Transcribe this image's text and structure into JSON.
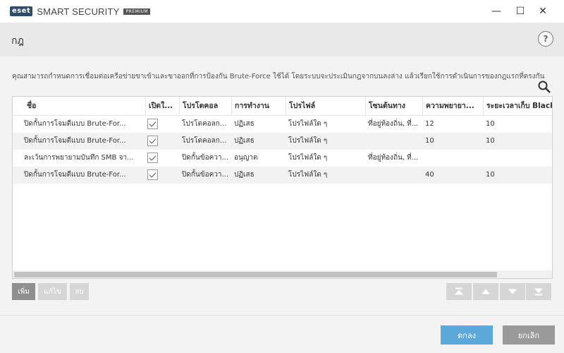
{
  "window": {
    "logo_text": "eset",
    "app_name": "SMART SECURITY",
    "edition": "PREMIUM",
    "minimize_glyph": "—",
    "maximize_glyph": "☐",
    "close_glyph": "✕"
  },
  "header": {
    "title": "กฎ",
    "help_label": "?"
  },
  "description": "คุณสามารถกำหนดการเชื่อมต่อเครือข่ายขาเข้าและขาออกที่การป้องกัน Brute-Force ใช้ได้ โดยระบบจะประเมินกฎจากบนลงล่าง แล้วเรียกใช้การดำเนินการของกฎแรกที่ตรงกัน",
  "table": {
    "columns": [
      "ชื่อ",
      "เปิดใ...",
      "โปรโตคอล",
      "การทำงาน",
      "โปรไฟล์",
      "โซนต้นทาง",
      "ความพยายา...",
      "ระยะเวลาเก็บ Black"
    ],
    "rows": [
      {
        "name": "ปิดกั้นการโจมตีแบบ Brute-For...",
        "enabled": true,
        "protocol": "โปรโตคอลก...",
        "action": "ปฏิเสธ",
        "profile": "โปรไฟล์ใด ๆ",
        "zone": "ที่อยู่ท้องถิ่น, ที่...",
        "attempts": "12",
        "retention": "10"
      },
      {
        "name": "ปิดกั้นการโจมตีแบบ Brute-For...",
        "enabled": true,
        "protocol": "โปรโตคอลก...",
        "action": "ปฏิเสธ",
        "profile": "โปรไฟล์ใด ๆ",
        "zone": "",
        "attempts": "10",
        "retention": "10"
      },
      {
        "name": "ละเว้นการพยายามบันทึก SMB จา...",
        "enabled": true,
        "protocol": "ปิดกั้นข้อควา...",
        "action": "อนุญาต",
        "profile": "โปรไฟล์ใด ๆ",
        "zone": "ที่อยู่ท้องถิ่น, ที่...",
        "attempts": "",
        "retention": ""
      },
      {
        "name": "ปิดกั้นการโจมตีแบบ Brute-For...",
        "enabled": true,
        "protocol": "ปิดกั้นข้อควา...",
        "action": "ปฏิเสธ",
        "profile": "โปรไฟล์ใด ๆ",
        "zone": "",
        "attempts": "40",
        "retention": "10"
      }
    ]
  },
  "buttons": {
    "add": "เพิ่ม",
    "edit": "แก้ไข",
    "delete": "ลบ",
    "ok": "ตกลง",
    "cancel": "ยกเลิก"
  },
  "icons": {
    "search": "search-icon",
    "move_top": "move-top-icon",
    "move_up": "move-up-icon",
    "move_down": "move-down-icon",
    "move_bottom": "move-bottom-icon"
  },
  "colors": {
    "ok_button": "#5aa9d8",
    "cancel_button": "#9a9a9a",
    "logo": "#2d4d6b"
  }
}
